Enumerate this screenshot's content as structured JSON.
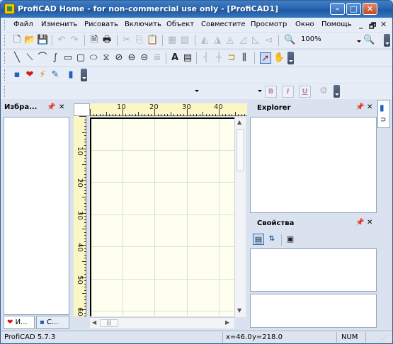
{
  "window": {
    "title": "ProfiCAD Home - for non-commercial use only - [ProfiCAD1]"
  },
  "menu": [
    "Файл",
    "Изменить",
    "Рисовать",
    "Включить",
    "Объект",
    "Совместите",
    "Просмотр",
    "Окно",
    "Помощь"
  ],
  "zoom": {
    "value": "100%"
  },
  "left_panel": {
    "title": "Избра...",
    "tabs": [
      "И...",
      "С..."
    ]
  },
  "explorer": {
    "title": "Explorer"
  },
  "properties": {
    "title": "Свойства"
  },
  "format_toolbar": {
    "bold": "B",
    "italic": "I",
    "underline": "U"
  },
  "text_tool": "A",
  "ruler": {
    "top": [
      "10",
      "20",
      "30",
      "40"
    ],
    "left": [
      "10",
      "20",
      "30",
      "40",
      "50",
      "60"
    ]
  },
  "statusbar": {
    "version": "ProfiCAD 5.7.3",
    "x": "x=46.0",
    "y": "y=218.0",
    "num": "NUM"
  },
  "colors": {
    "titlebar": "#2a66b0",
    "ruler": "#fbf7c4",
    "canvas": "#fffff0",
    "grid": "#d8dfe3"
  }
}
